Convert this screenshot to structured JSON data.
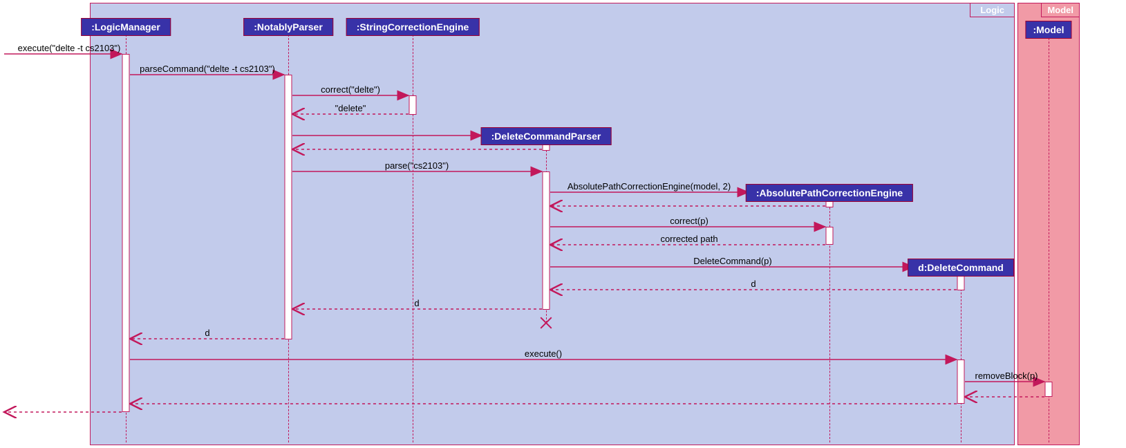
{
  "frames": {
    "logic": {
      "label": "Logic"
    },
    "model": {
      "label": "Model"
    }
  },
  "participants": {
    "logicManager": ":LogicManager",
    "notablyParser": ":NotablyParser",
    "stringCorrectionEngine": ":StringCorrectionEngine",
    "deleteCommandParser": ":DeleteCommandParser",
    "absolutePathCorrectionEngine": ":AbsolutePathCorrectionEngine",
    "deleteCommand": "d:DeleteCommand",
    "model": ":Model"
  },
  "messages": {
    "execute1": "execute(\"delte -t cs2103\")",
    "parseCommand": "parseCommand(\"delte -t cs2103\")",
    "correctDelte": "correct(\"delte\")",
    "deleteLiteral": "\"delete\"",
    "parseCs2103": "parse(\"cs2103\")",
    "apceCtor": "AbsolutePathCorrectionEngine(model, 2)",
    "correctP": "correct(p)",
    "correctedPath": "corrected path",
    "deleteCommandP": "DeleteCommand(p)",
    "d1": "d",
    "d2": "d",
    "d3": "d",
    "execute2": "execute()",
    "removeBlockP": "removeBlock(p)"
  }
}
